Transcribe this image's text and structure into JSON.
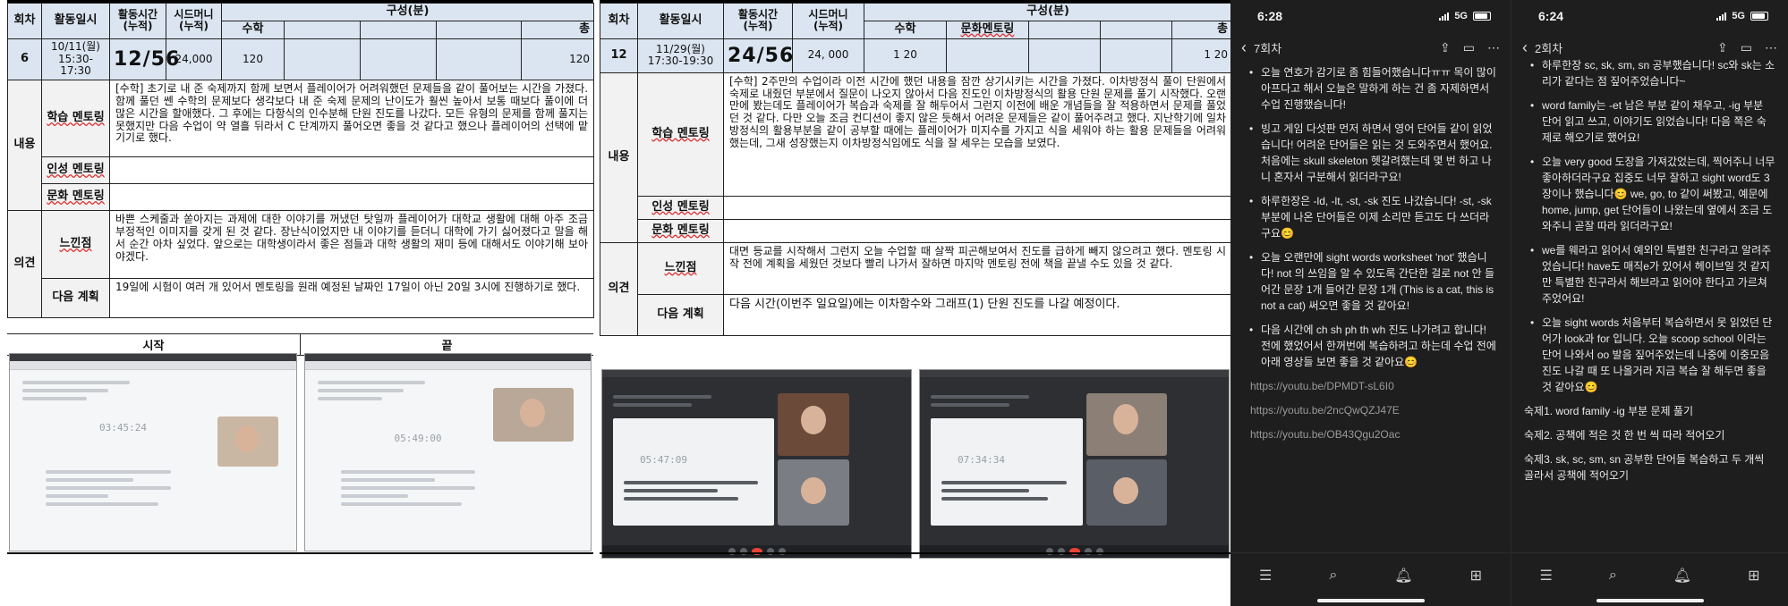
{
  "doc1": {
    "header": {
      "col_round": "회차",
      "col_date": "활동일시",
      "col_time": "활동시간\n(누적)",
      "col_seed": "시드머니\n(누적)",
      "col_comp": "구성(분)",
      "sub_math": "수학",
      "sub_total": "총"
    },
    "row": {
      "round": "6",
      "date": "10/11(월)\n15:30-17:30",
      "hours": "12/56",
      "seed": "24,000",
      "math": "120",
      "total": "120"
    },
    "content_label": "내용",
    "study_label": "학습 멘토링",
    "study_text": "[수학] 초기로 내 준 숙제까지 함께 보면서 플레이어가 어려워했던 문제들을 같이 풀어보는 시간을 가졌다. 함께 풀던 쎈 수학의 문제보다 생각보다 내 준 숙제 문제의 난이도가 훨씬 높아서 보통 때보다 풀이에 더 많은 시간을 할애했다. 그 후에는 다항식의 인수분해 단원 진도를 나갔다. 모든 유형의 문제를 함께 풀지는 못했지만 다음 수업이 약 열흘 뒤라서 C 단계까지 풀어오면 좋을 것 같다고 했으나 플레이어의 선택에 맡기기로 했다.",
    "char_label": "인성 멘토링",
    "culture_label": "문화 멘토링",
    "opinion_label": "의견",
    "feel_label": "느낀점",
    "feel_text": "바쁜 스케줄과 쏟아지는 과제에 대한 이야기를 꺼냈던 탓일까 플레이어가 대학교 생활에 대해 아주 조금 부정적인 이미지를 갖게 된 것 같다. 장난식이었지만 내 이야기를 듣더니 대학에 가기 싫어졌다고 말을 해서 순간 아차 싶었다. 앞으로는 대학생이라서 좋은 점들과 대학 생활의 재미 등에 대해서도 이야기해 보아야겠다.",
    "plan_label": "다음 계획",
    "plan_text": "19일에 시험이 여러 개 있어서 멘토링을 원래 예정된 날짜인 17일이 아닌 20일 3시에 진행하기로 했다.",
    "start_label": "시작",
    "end_label": "끝",
    "timer1": "03:45:24",
    "timer2": "05:49:00"
  },
  "doc2": {
    "header": {
      "col_round": "회차",
      "col_date": "활동일시",
      "col_time": "활동시간\n(누적)",
      "col_seed": "시드머니\n(누적)",
      "col_comp": "구성(분)",
      "sub_math": "수학",
      "sub_culture": "문화멘토링",
      "sub_total": "총"
    },
    "row": {
      "round": "12",
      "date": "11/29(월)\n17:30-19:30",
      "hours": "24/56",
      "seed": "24, 000",
      "math": "1 20",
      "total": "1 20"
    },
    "content_label": "내용",
    "study_label": "학습 멘토링",
    "study_text": "[수학] 2주만의 수업이라 이전 시간에 했던 내용을 잠깐 상기시키는 시간을 가졌다. 이차방정식 풀이 단원에서 숙제로 내줬던 부분에서 질문이 나오지 않아서 다음 진도인 이차방정식의 활용 단원 문제를 풀기 시작했다. 오랜만에 봤는데도 플레이어가 복습과 숙제를 잘 해두어서 그런지 이전에 배운 개념들을 잘 적용하면서 문제를 풀었던 것 같다. 다만 오늘 조금 컨디션이 좋지 않은 듯해서 어려운 문제들은 같이 풀어주려고 했다. 지난학기에 일차방정식의 활용부분을 같이 공부할 때에는 플레이어가 미지수를 가지고 식을 세워야 하는 활용 문제들을 어려워했는데, 그새 성장했는지 이차방정식임에도 식을 잘 세우는 모습을 보였다.",
    "char_label": "인성 멘토링",
    "culture_label": "문화 멘토링",
    "opinion_label": "의견",
    "feel_label": "느낀점",
    "feel_text": "대면 등교를 시작해서 그런지 오늘 수업할 때 살짝 피곤해보여서 진도를 급하게 빼지 않으려고 했다. 멘토링 시작 전에 계획을 세웠던 것보다 빨리 나가서 잘하면 마지막 멘토링 전에 책을 끝낼 수도 있을 것 같다.",
    "plan_label": "다음 계획",
    "plan_text": "다음 시간(이번주 일요일)에는 이차함수와 그래프(1) 단원 진도를 나갈 예정이다.",
    "timer1": "05:47:09",
    "timer2": "07:34:34"
  },
  "phone1": {
    "time": "6:28",
    "network": "5G",
    "nav_title": "7회차",
    "bullets": [
      "오늘 연호가 감기로 좀 힘들어했습니다ㅠㅠ 목이 많이 아프다고 해서 오늘은 말하게 하는 건 좀 자제하면서 수업 진행했습니다!",
      "빙고 게임 다섯판 먼저 하면서 영어 단어들 같이 읽었습니다! 어려운 단어들은 읽는 것 도와주면서 했어요. 처음에는 skull skeleton 헷갈려했는데 몇 번 하고 나니 혼자서 구분해서 읽더라구요!",
      "하루한장은 -ld, -lt, -st, -sk 진도 나갔습니다! -st, -sk 부분에 나온 단어들은 이제 소리만 듣고도 다 쓰더라구요😊",
      "오늘 오랜만에 sight words worksheet 'not' 했습니다! not 의 쓰임을 알 수 있도록 간단한 걸로 not 안 들어간 문장 1개 들어간 문장 1개 (This is a cat, this is not a cat) 써오면 좋을 것 같아요!",
      "다음 시간에 ch sh ph th wh 진도 나가려고 합니다! 전에 했었어서 한꺼번에 복습하려고 하는데 수업 전에 아래 영상들 보면 좋을 것 같아요😊"
    ],
    "links": [
      "https://youtu.be/DPMDT-sL6I0",
      "https://youtu.be/2ncQwQZJ47E",
      "https://youtu.be/OB43Qgu2Oac"
    ]
  },
  "phone2": {
    "time": "6:24",
    "network": "5G",
    "nav_title": "2회차",
    "bullets": [
      "하루한장 sc, sk, sm, sn 공부했습니다! sc와 sk는 소리가 같다는 점 짚어주었습니다~",
      "word family는 -et 남은 부분 같이 채우고, -ig 부분 단어 읽고 쓰고, 이야기도 읽었습니다! 다음 쪽은 숙제로 해오기로 했어요!",
      "오늘 very good 도장을 가져갔었는데, 찍어주니 너무 좋아하더라구요 집중도 너무 잘하고 sight word도 3장이나 했습니다😊 we, go, to 같이 써봤고, 예문에 home, jump, get 단어들이 나왔는데 옆에서 조금 도와주니 곧잘 따라 읽더라구요!",
      "we를 웨라고 읽어서 예외인 특별한 친구라고 알려주었습니다! have도 매직e가 있어서 헤이브일 것 같지만 특별한 친구라서 해브라고 읽어야 한다고 가르쳐 주었어요!",
      "오늘 sight words 처음부터 복습하면서 못 읽었던 단어가 look과 for 입니다. 오늘 scoop school 이라는 단어 나와서 oo 발음 짚어주었는데 나중에 이중모음 진도 나갈 때 또 나올거라 지금 복습 잘 해두면 좋을 것 같아요😊"
    ],
    "homework": [
      "숙제1. word family -ig 부분 문제 풀기",
      "숙제2. 공책에 적은 것 한 번 씩 따라 적어오기",
      "숙제3. sk, sc, sm, sn 공부한 단어들 복습하고 두 개씩 골라서 공책에 적어오기"
    ]
  }
}
